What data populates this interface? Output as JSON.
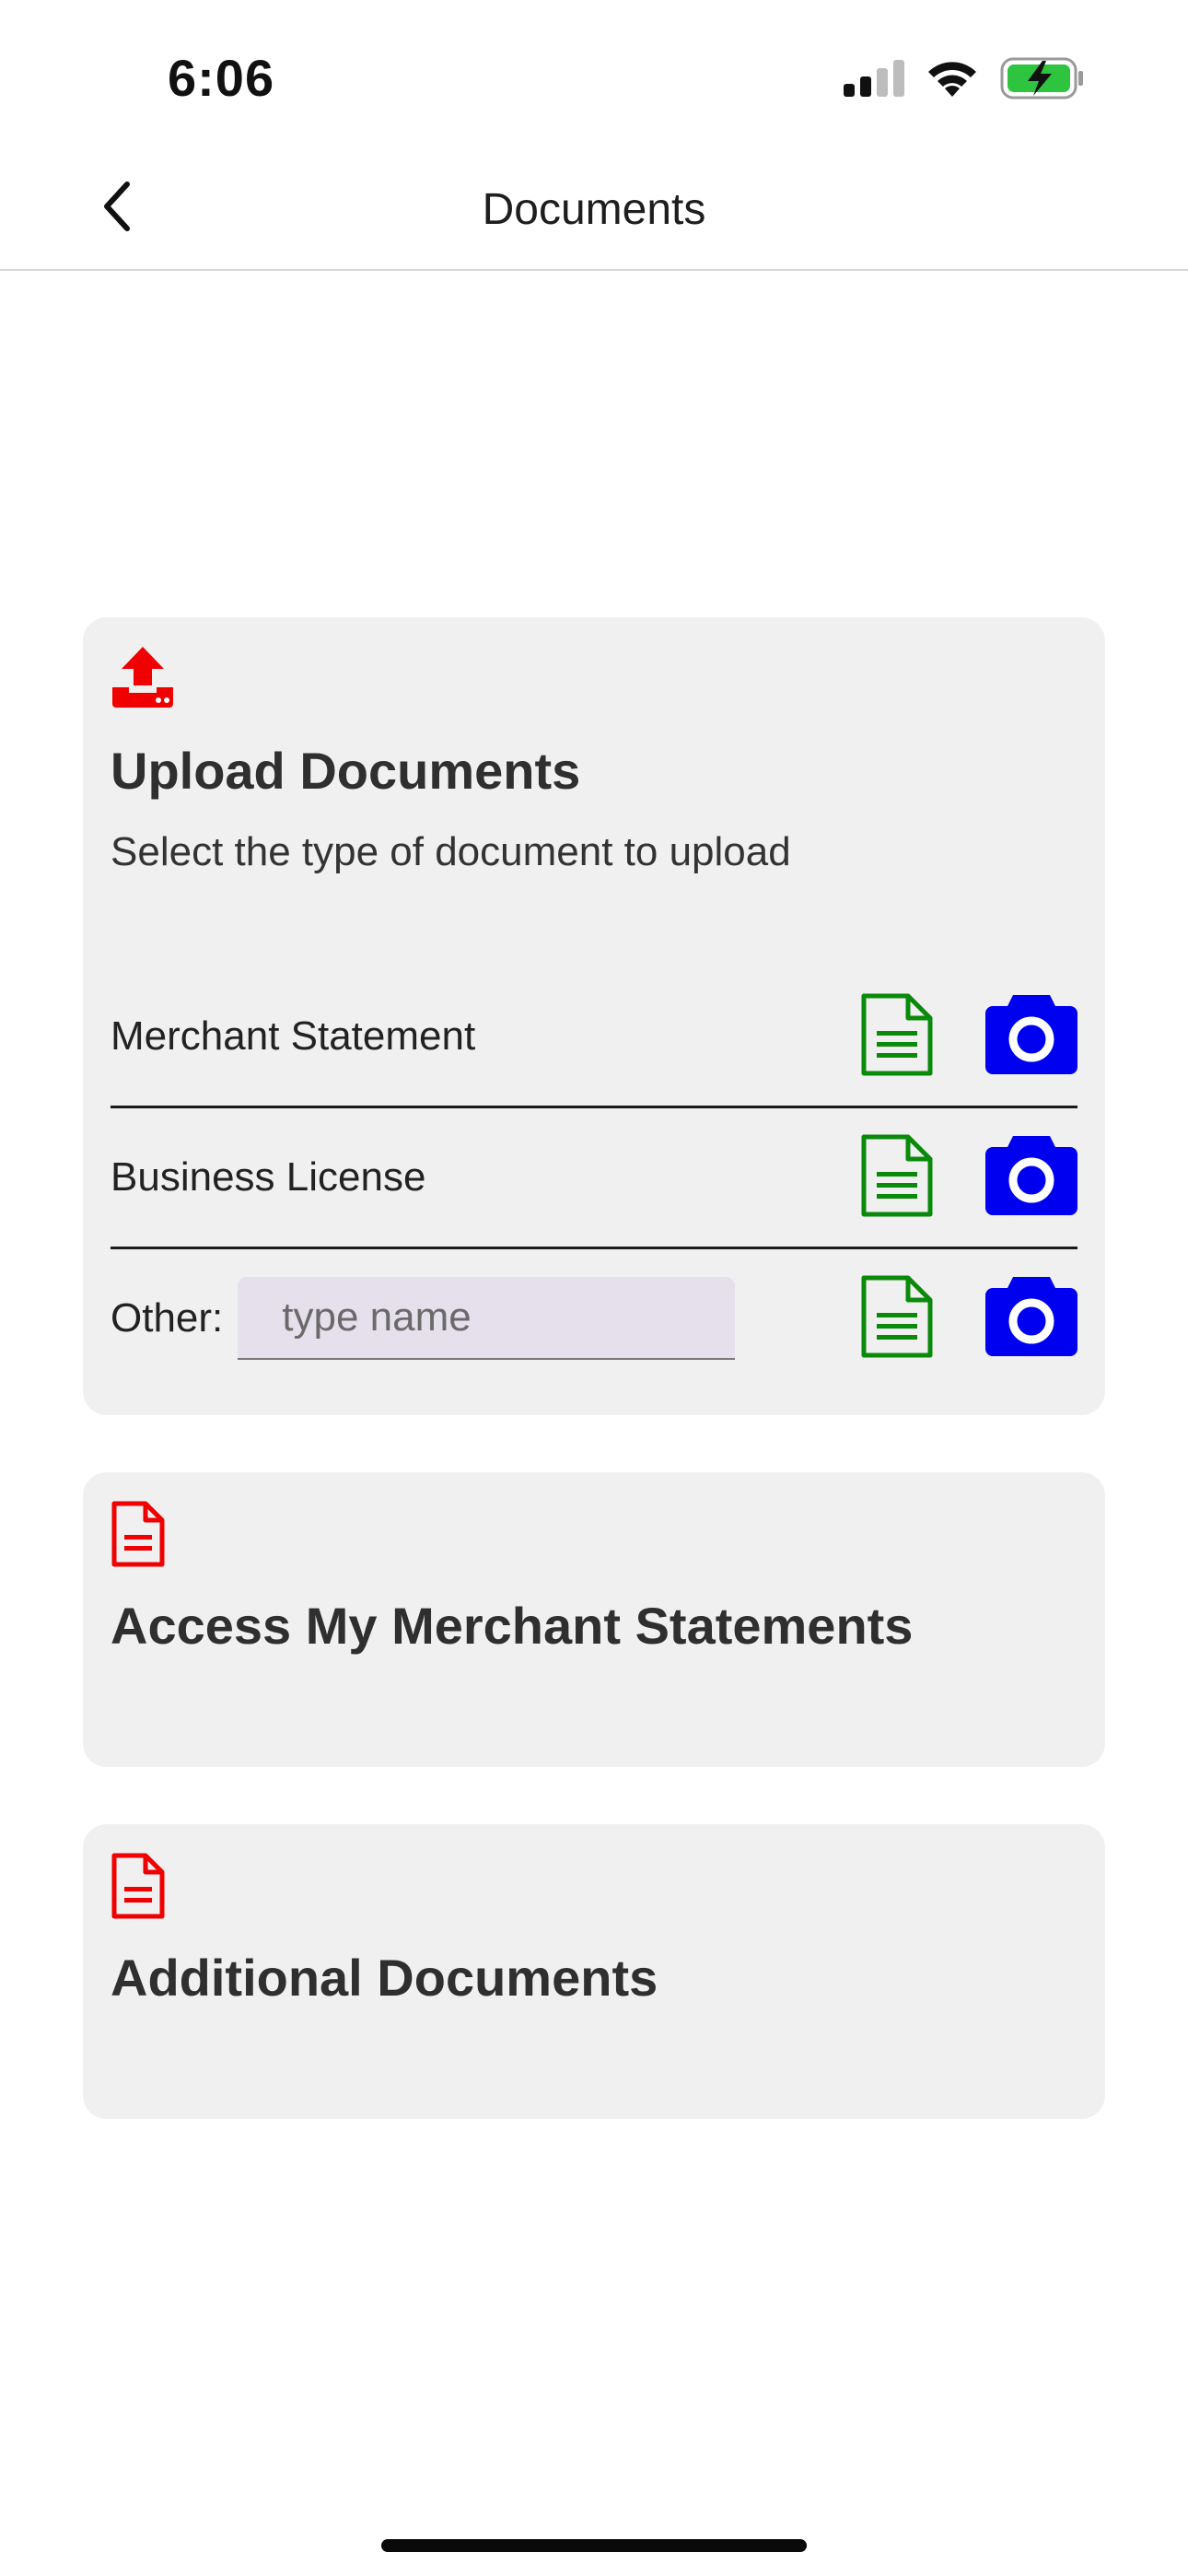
{
  "status_bar": {
    "time": "6:06"
  },
  "nav": {
    "title": "Documents"
  },
  "upload_card": {
    "title": "Upload Documents",
    "subtitle": "Select the type of document to upload",
    "rows": [
      {
        "label": "Merchant Statement"
      },
      {
        "label": "Business License"
      },
      {
        "label": "Other:",
        "input_placeholder": "type name",
        "input_value": ""
      }
    ]
  },
  "access_card": {
    "title": "Access My Merchant Statements"
  },
  "additional_card": {
    "title": "Additional Documents"
  },
  "colors": {
    "accent_red": "#f00000",
    "file_green": "#0a8a0a",
    "camera_blue": "#0000f0",
    "card_bg": "#f0f0f0",
    "input_bg": "#e6e0ec",
    "battery_green": "#2ec43f"
  },
  "icons": {
    "back": "chevron-left-icon",
    "upload": "upload-icon",
    "file": "file-document-icon",
    "camera": "camera-icon",
    "doc": "document-icon"
  }
}
